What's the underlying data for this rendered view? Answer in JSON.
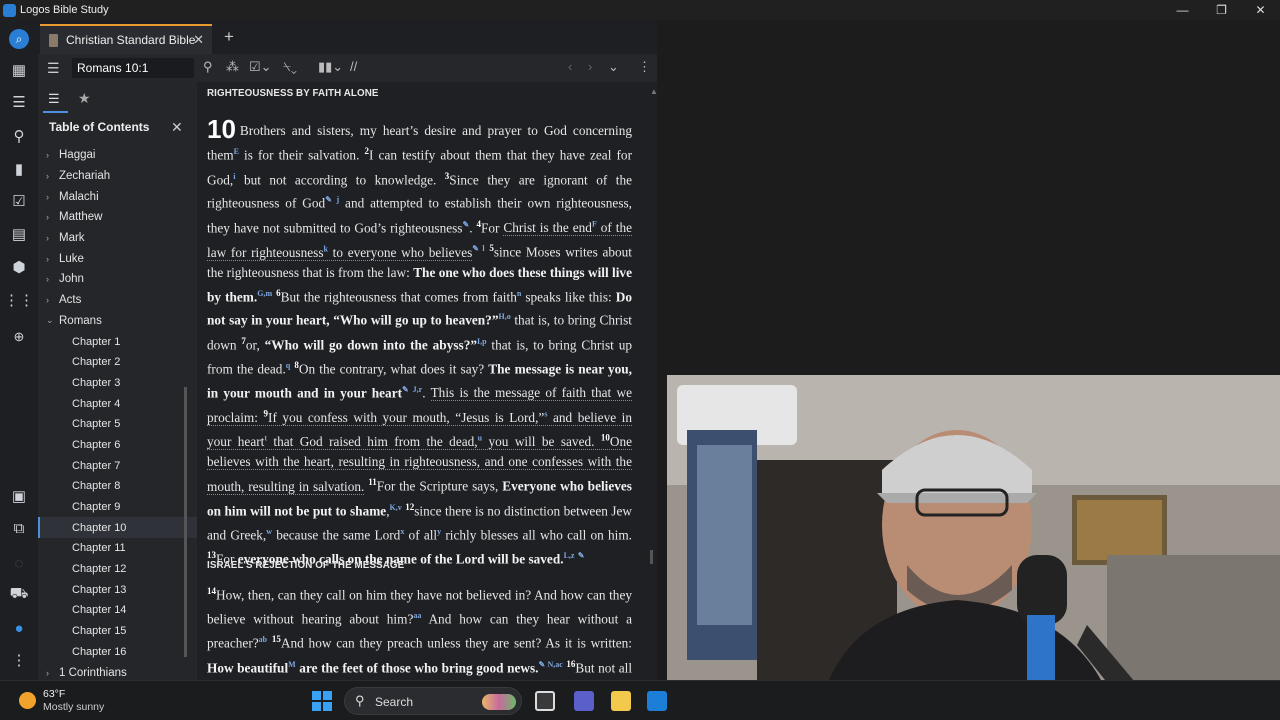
{
  "window": {
    "title": "Logos Bible Study",
    "buttons": {
      "minimize": "—",
      "maximize": "❐",
      "close": "✕"
    }
  },
  "tab": {
    "label": "Christian Standard Bible",
    "close": "✕",
    "new_tab": "+"
  },
  "toolbar": {
    "reference": "Romans 10:1"
  },
  "sidebar": {
    "heading": "Table of Contents",
    "close": "✕",
    "items": [
      {
        "label": "Haggai",
        "chevron": "›"
      },
      {
        "label": "Zechariah",
        "chevron": "›"
      },
      {
        "label": "Malachi",
        "chevron": "›"
      },
      {
        "label": "Matthew",
        "chevron": "›"
      },
      {
        "label": "Mark",
        "chevron": "›"
      },
      {
        "label": "Luke",
        "chevron": "›"
      },
      {
        "label": "John",
        "chevron": "›"
      },
      {
        "label": "Acts",
        "chevron": "›"
      },
      {
        "label": "Romans",
        "chevron": "⌄"
      },
      {
        "label": "Chapter 1"
      },
      {
        "label": "Chapter 2"
      },
      {
        "label": "Chapter 3"
      },
      {
        "label": "Chapter 4"
      },
      {
        "label": "Chapter 5"
      },
      {
        "label": "Chapter 6"
      },
      {
        "label": "Chapter 7"
      },
      {
        "label": "Chapter 8"
      },
      {
        "label": "Chapter 9"
      },
      {
        "label": "Chapter 10"
      },
      {
        "label": "Chapter 11"
      },
      {
        "label": "Chapter 12"
      },
      {
        "label": "Chapter 13"
      },
      {
        "label": "Chapter 14"
      },
      {
        "label": "Chapter 15"
      },
      {
        "label": "Chapter 16"
      },
      {
        "label": "1 Corinthians",
        "chevron": "›"
      }
    ],
    "selected": "Chapter 10"
  },
  "reader": {
    "heading1": "RIGHTEOUSNESS BY FAITH ALONE",
    "chapter_number": "10",
    "heading2": "ISRAEL'S REJECTION OF THE MESSAGE"
  },
  "taskbar": {
    "temperature": "63°F",
    "condition": "Mostly sunny",
    "search_label": "Search"
  },
  "colors": {
    "accent": "#4b8fe0",
    "tab_accent": "#e69a2f",
    "link": "#7da7e0"
  }
}
